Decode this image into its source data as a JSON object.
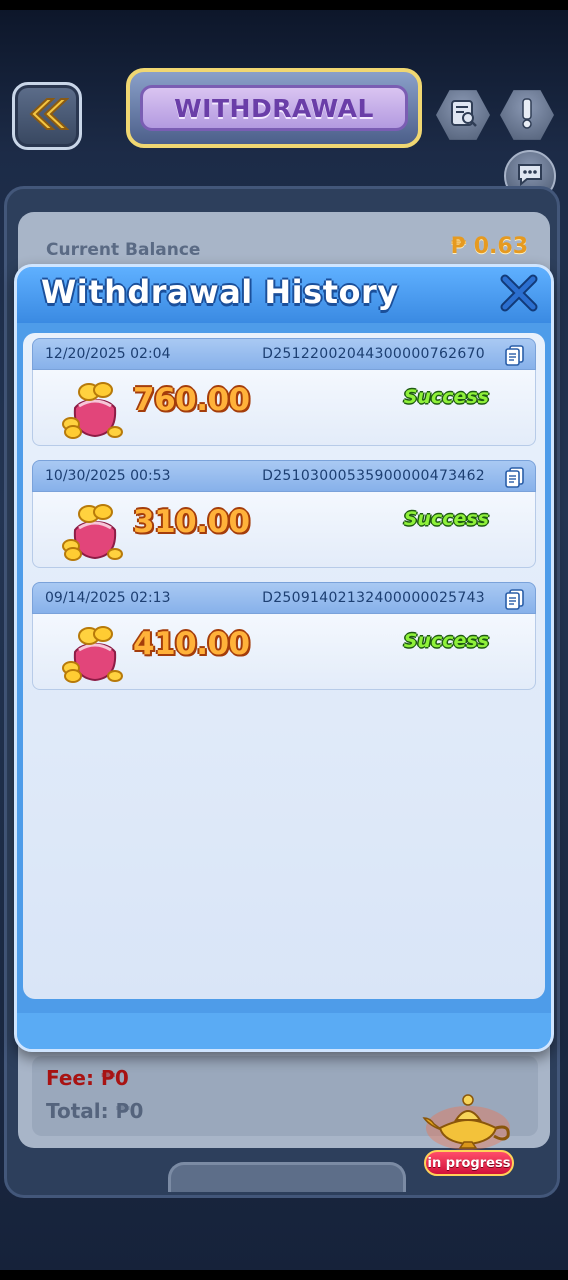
{
  "header": {
    "title": "WITHDRAWAL"
  },
  "balance": {
    "label": "Current Balance",
    "value": "₱ 0.63"
  },
  "summary": {
    "fee": "Fee: ₱0",
    "total": "Total: ₱0"
  },
  "modal": {
    "title": "Withdrawal History",
    "records": [
      {
        "date": "12/20/2025 02:04",
        "id": "D25122002044300000762670",
        "amount": "760.00",
        "status": "Success"
      },
      {
        "date": "10/30/2025 00:53",
        "id": "D25103000535900000473462",
        "amount": "310.00",
        "status": "Success"
      },
      {
        "date": "09/14/2025 02:13",
        "id": "D25091402132400000025743",
        "amount": "410.00",
        "status": "Success"
      }
    ]
  },
  "progress_widget": {
    "label": "in progress"
  },
  "colors": {
    "modal_blue": "#4e9ce9",
    "success_green": "#8ff13a",
    "amount_orange": "#ffb23a",
    "fee_red": "#a81313"
  }
}
